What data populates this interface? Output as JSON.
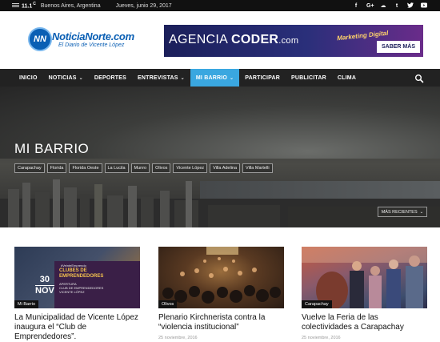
{
  "topbar": {
    "temperature": "11.1",
    "temperature_unit": "C",
    "city": "Buenos Aires, Argentina",
    "date": "Jueves, junio 29, 2017",
    "social_icons": [
      "facebook-icon",
      "google-plus-icon",
      "soundcloud-icon",
      "tumblr-icon",
      "twitter-icon",
      "youtube-icon"
    ]
  },
  "header": {
    "logo_badge": "NN",
    "logo_name": "NoticiaNorte.com",
    "logo_tagline": "El Diario de Vicente López",
    "ad": {
      "brand_regular": "AGENCIA ",
      "brand_bold": "CODER",
      "brand_suffix": ".com",
      "script_text": "Marketing Digital",
      "cta": "SABER MÁS"
    }
  },
  "nav": {
    "items": [
      {
        "label": "INICIO",
        "dropdown": false,
        "active": false
      },
      {
        "label": "NOTICIAS",
        "dropdown": true,
        "active": false
      },
      {
        "label": "DEPORTES",
        "dropdown": false,
        "active": false
      },
      {
        "label": "ENTREVISTAS",
        "dropdown": true,
        "active": false
      },
      {
        "label": "MI BARRIO",
        "dropdown": true,
        "active": true
      },
      {
        "label": "PARTICIPAR",
        "dropdown": false,
        "active": false
      },
      {
        "label": "PUBLICITAR",
        "dropdown": false,
        "active": false
      },
      {
        "label": "CLIMA",
        "dropdown": false,
        "active": false
      }
    ],
    "accent_color": "#3aa7e0"
  },
  "hero": {
    "title": "MI BARRIO",
    "tags": [
      "Carapachay",
      "Florida",
      "Florida Oeste",
      "La Lucila",
      "Munro",
      "Olivos",
      "Vicente López",
      "Villa Adelina",
      "Villa Martelli"
    ],
    "sort_label": "MÁS RECIENTES"
  },
  "cards": [
    {
      "category": "Mi Barrio",
      "title": "La Municipalidad de Vicente López inaugura el “Club de Emprendedores”.",
      "date": "",
      "image_text": {
        "hashtag": "#VeinteEmprendo",
        "heading_line1": "CLUBES DE",
        "heading_line2": "EMPRENDEDORES",
        "sub_line1": "APERTURA",
        "sub_line2": "CLUB DE EMPRENDEDORES",
        "sub_line3": "VICENTE LÓPEZ",
        "day": "30",
        "month": "NOV"
      }
    },
    {
      "category": "Olivos",
      "title": "Plenario Kirchnerista contra la “violencia institucional”",
      "date": "25 noviembre, 2016"
    },
    {
      "category": "Carapachay",
      "title": "Vuelve la Feria de las colectividades a Carapachay",
      "date": "25 noviembre, 2016"
    }
  ]
}
